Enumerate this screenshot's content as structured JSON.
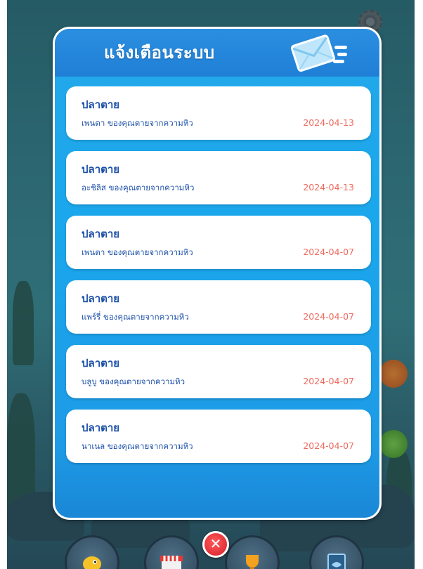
{
  "panel": {
    "title": "แจ้งเตือนระบบ",
    "icon": "envelope-icon"
  },
  "notifications": [
    {
      "title": "ปลาตาย",
      "message": "เพนตา ของคุณตายจากความหิว",
      "date": "2024-04-13"
    },
    {
      "title": "ปลาตาย",
      "message": "อะชิลิส ของคุณตายจากความหิว",
      "date": "2024-04-13"
    },
    {
      "title": "ปลาตาย",
      "message": "เพนตา ของคุณตายจากความหิว",
      "date": "2024-04-07"
    },
    {
      "title": "ปลาตาย",
      "message": "แพร์รี่ ของคุณตายจากความหิว",
      "date": "2024-04-07"
    },
    {
      "title": "ปลาตาย",
      "message": "บลูบู ของคุณตายจากความหิว",
      "date": "2024-04-07"
    },
    {
      "title": "ปลาตาย",
      "message": "นาเนล ของคุณตายจากความหิว",
      "date": "2024-04-07"
    }
  ],
  "nav": {
    "items": [
      {
        "icon": "fish-character-icon"
      },
      {
        "icon": "shop-icon"
      },
      {
        "icon": "trophy-icon"
      },
      {
        "icon": "fish-book-icon"
      }
    ],
    "close_icon": "close-icon"
  },
  "colors": {
    "panel_blue": "#1aa7ec",
    "header_blue": "#2b8fe0",
    "title_text": "#1b4fa8",
    "date_text": "#ef6a5e",
    "close_red": "#d31f2a"
  }
}
